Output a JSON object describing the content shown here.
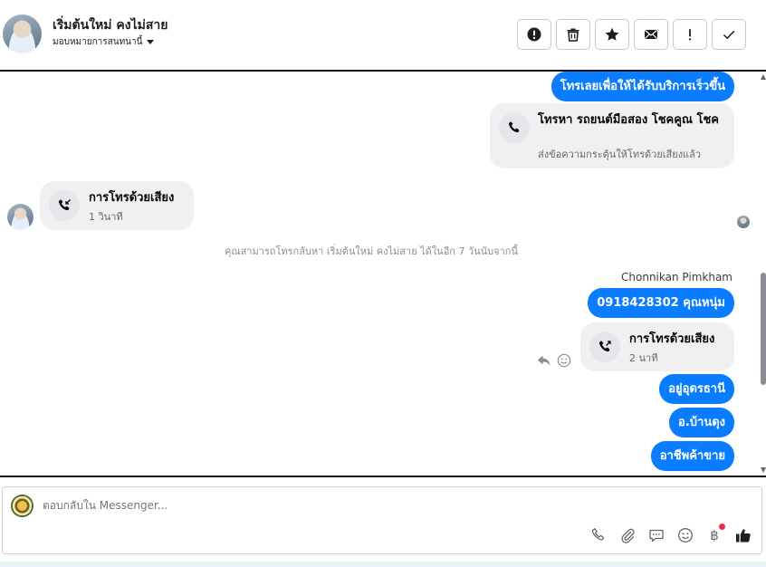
{
  "header": {
    "contact_name": "เริ่มต้นใหม่ คงไม่สาย",
    "assign_label": "มอบหมายการสนทนานี้",
    "actions": [
      {
        "icon": "alert-circle-icon",
        "name": "mark-spam-button"
      },
      {
        "icon": "trash-icon",
        "name": "delete-button"
      },
      {
        "icon": "star-icon",
        "name": "star-button"
      },
      {
        "icon": "mail-icon",
        "name": "mark-unread-button"
      },
      {
        "icon": "exclamation-icon",
        "name": "follow-up-button"
      },
      {
        "icon": "check-icon",
        "name": "mark-done-button"
      }
    ]
  },
  "messages": {
    "out1": "โทรเลยเพื่อให้ได้รับบริการเร็วขึ้น",
    "call_prompt": {
      "title": "โทรหา รถยนต์มือสอง โชคคูณ โชค",
      "subtitle": "ส่งข้อความกระตุ้นให้โทรด้วยเสียงแล้ว"
    },
    "incoming_call": {
      "title": "การโทรด้วยเสียง",
      "subtitle": "1 วินาที"
    },
    "notice": "คุณสามารถโทรกลับหา เริ่มต้นใหม่ คงไม่สาย ได้ในอีก 7 วันนับจากนี้",
    "sender_name": "Chonnikan Pimkham",
    "out2": "0918428302 คุณหนุ่ม",
    "outgoing_call": {
      "title": "การโทรด้วยเสียง",
      "subtitle": "2 นาที"
    },
    "out3": "อยู่อุดรธานี",
    "out4": "อ.บ้านดุง",
    "out5": "อาชีพค้าขาย"
  },
  "composer": {
    "placeholder": "ตอบกลับใน Messenger...",
    "tools": [
      "phone-icon",
      "paperclip-icon",
      "saved-reply-icon",
      "emoji-icon",
      "baht-payment-icon",
      "like-icon"
    ],
    "baht_symbol": "฿"
  },
  "colors": {
    "bubble_out": "#0a7cff",
    "card_bg": "#f0f0f0",
    "notice_text": "#8a8d91",
    "notification_dot": "#f02849"
  }
}
